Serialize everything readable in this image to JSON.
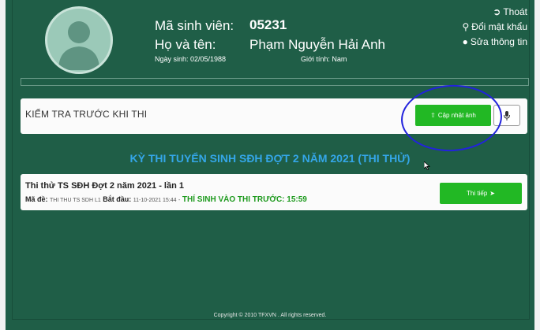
{
  "profile": {
    "student_id_label": "Mã sinh viên:",
    "student_id": "05231",
    "name_label": "Họ và tên:",
    "name": "Phạm Nguyễn Hải Anh",
    "dob": "Ngày sinh: 02/05/1988",
    "gender": "Giới tính: Nam"
  },
  "header_links": {
    "logout": "Thoát",
    "change_password": "Đổi mật khẩu",
    "edit_info": "Sửa thông tin"
  },
  "precheck": {
    "title": "KIỂM TRA TRƯỚC KHI THI",
    "update_photo_button": "Cập nhật ảnh"
  },
  "exam_session": {
    "title": "KỲ THI TUYỂN SINH SĐH ĐỢT 2 NĂM 2021 (THI THỬ)",
    "exam": {
      "name": "Thi thử TS SĐH Đợt 2 năm 2021 - lần 1",
      "code_label": "Mã đề:",
      "code": "THI THU TS SDH L1",
      "start_label": "Bắt đầu:",
      "start": "11-10-2021 15:44",
      "separator": "-",
      "entry_notice": "THÍ SINH VÀO THI TRƯỚC: 15:59",
      "continue_button": "Thi tiếp"
    }
  },
  "footer": "Copyright © 2010 TFXVN . All rights reserved.",
  "colors": {
    "background": "#1f5e47",
    "button_green": "#22b824",
    "title_blue": "#34a6e8",
    "notice_green": "#1e9a1e",
    "annotation_blue": "#2222dd"
  }
}
